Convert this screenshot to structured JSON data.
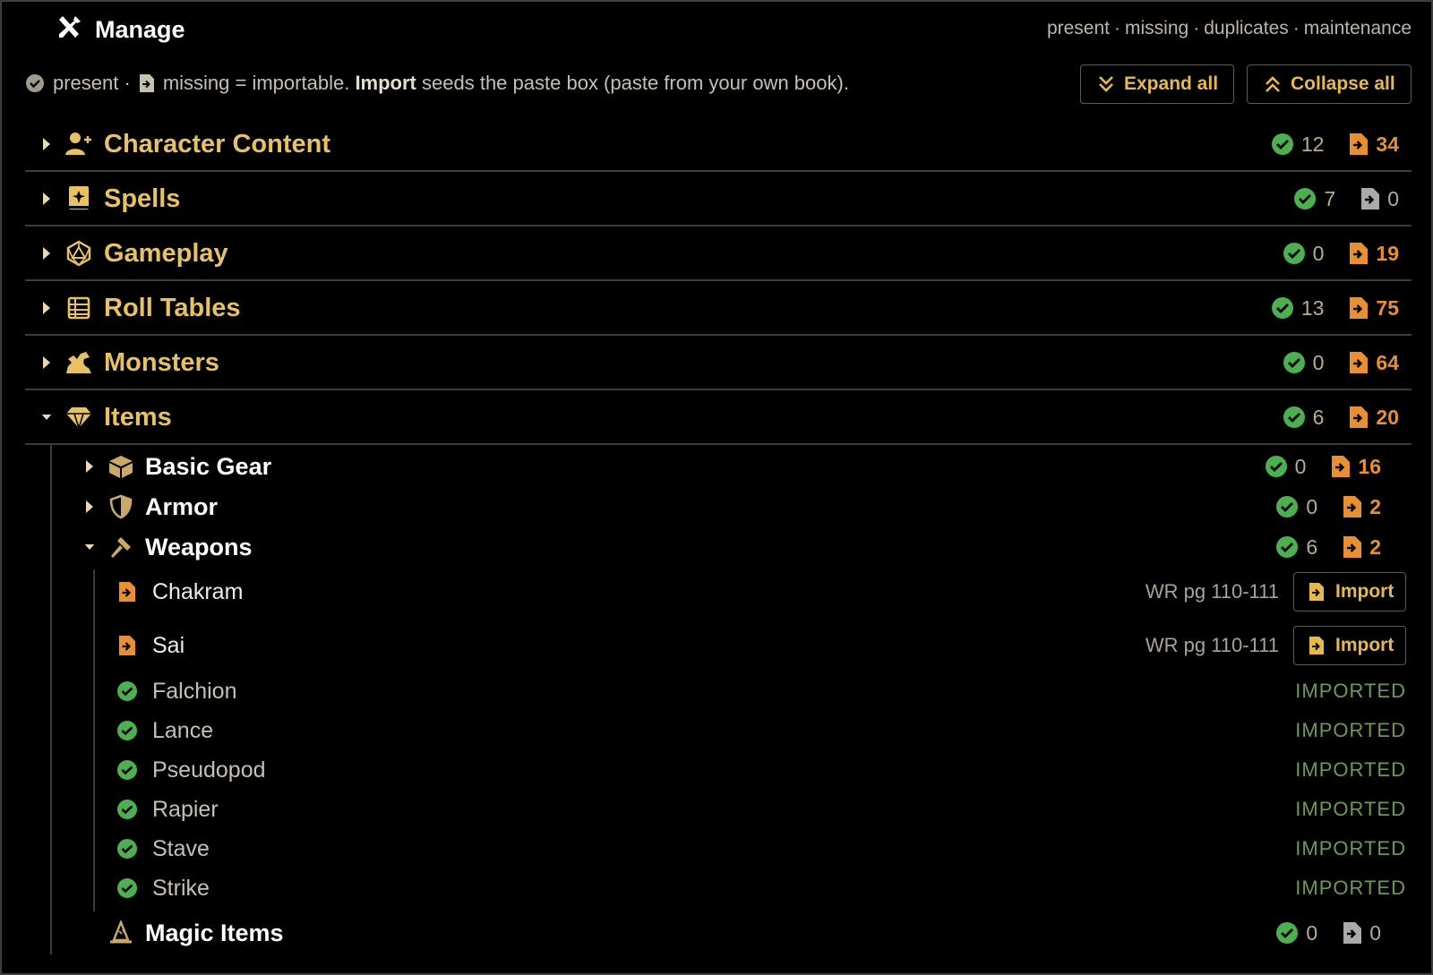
{
  "header": {
    "title": "Manage"
  },
  "nav": [
    "present",
    "missing",
    "duplicates",
    "maintenance"
  ],
  "legend": {
    "present": "present ·",
    "missing_pre": "missing = importable.",
    "import_word": "Import",
    "rest": "seeds the paste box (paste from your own book)."
  },
  "buttons": {
    "expand": "Expand all",
    "collapse": "Collapse all"
  },
  "categories": [
    {
      "label": "Character Content",
      "icon": "user-plus-icon",
      "present": "12",
      "missing": "34",
      "expanded": false
    },
    {
      "label": "Spells",
      "icon": "spellbook-icon",
      "present": "7",
      "missing": "0",
      "expanded": false
    },
    {
      "label": "Gameplay",
      "icon": "d20-icon",
      "present": "0",
      "missing": "19",
      "expanded": false
    },
    {
      "label": "Roll Tables",
      "icon": "table-icon",
      "present": "13",
      "missing": "75",
      "expanded": false
    },
    {
      "label": "Monsters",
      "icon": "dragon-icon",
      "present": "0",
      "missing": "64",
      "expanded": false
    },
    {
      "label": "Items",
      "icon": "gem-icon",
      "present": "6",
      "missing": "20",
      "expanded": true
    }
  ],
  "subcategories": [
    {
      "label": "Basic Gear",
      "icon": "box-icon",
      "present": "0",
      "missing": "16",
      "expanded": false
    },
    {
      "label": "Armor",
      "icon": "shield-icon",
      "present": "0",
      "missing": "2",
      "expanded": false
    },
    {
      "label": "Weapons",
      "icon": "hammer-icon",
      "present": "6",
      "missing": "2",
      "expanded": true
    },
    {
      "label": "Magic Items",
      "icon": "wizard-hat-icon",
      "present": "0",
      "missing": "0",
      "expanded": false
    }
  ],
  "weapons": {
    "missing": [
      {
        "name": "Chakram",
        "ref": "WR pg 110-111",
        "action": "Import"
      },
      {
        "name": "Sai",
        "ref": "WR pg 110-111",
        "action": "Import"
      }
    ],
    "present": [
      {
        "name": "Falchion",
        "status": "IMPORTED"
      },
      {
        "name": "Lance",
        "status": "IMPORTED"
      },
      {
        "name": "Pseudopod",
        "status": "IMPORTED"
      },
      {
        "name": "Rapier",
        "status": "IMPORTED"
      },
      {
        "name": "Stave",
        "status": "IMPORTED"
      },
      {
        "name": "Strike",
        "status": "IMPORTED"
      }
    ]
  },
  "colors": {
    "accent": "#e8c262",
    "button_text": "#e8b94a",
    "present": "#4caf50",
    "missing": "#e98f33",
    "imported": "#6a9a54",
    "background": "#000000"
  }
}
